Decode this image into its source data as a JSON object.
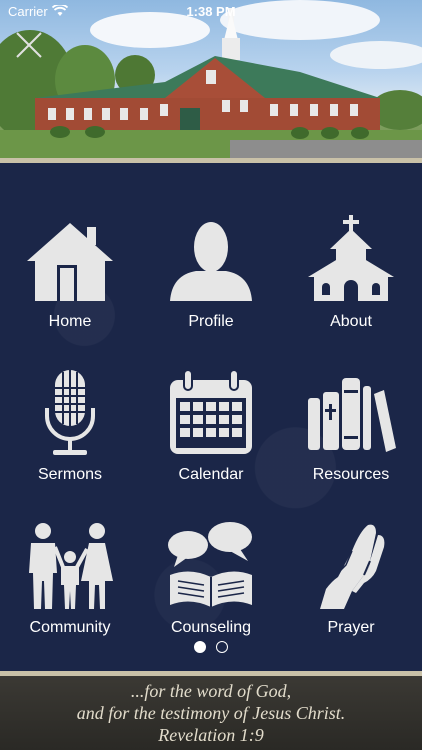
{
  "status_bar": {
    "carrier": "Carrier",
    "time": "1:38 PM"
  },
  "menu": [
    {
      "label": "Home",
      "icon": "house-icon"
    },
    {
      "label": "Profile",
      "icon": "person-icon"
    },
    {
      "label": "About",
      "icon": "church-icon"
    },
    {
      "label": "Sermons",
      "icon": "microphone-icon"
    },
    {
      "label": "Calendar",
      "icon": "calendar-icon"
    },
    {
      "label": "Resources",
      "icon": "books-icon"
    },
    {
      "label": "Community",
      "icon": "family-icon"
    },
    {
      "label": "Counseling",
      "icon": "bible-speech-icon"
    },
    {
      "label": "Prayer",
      "icon": "praying-hands-icon"
    }
  ],
  "pager": {
    "pages": 2,
    "current": 1
  },
  "footer": {
    "line1": "...for the word of God,",
    "line2": "and for the testimony of Jesus Christ.",
    "line3": "Revelation 1:9"
  },
  "colors": {
    "background": "#1b2648",
    "accent": "#c9c1a8",
    "icon": "#e6e6e6"
  }
}
